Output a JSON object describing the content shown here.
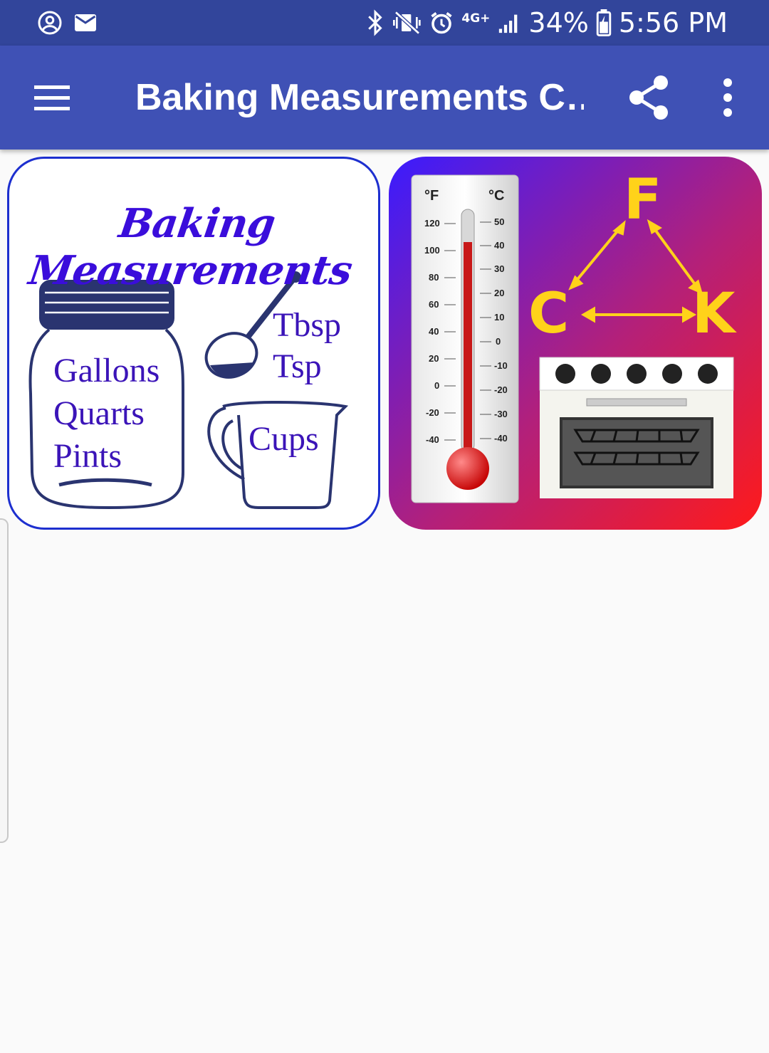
{
  "status_bar": {
    "network": "4G+",
    "battery": "34%",
    "time": "5:56 PM",
    "icons": [
      "account-circle-icon",
      "email-icon",
      "bluetooth-icon",
      "vibrate-icon",
      "alarm-icon",
      "signal-icon",
      "battery-charging-icon"
    ]
  },
  "app_bar": {
    "title": "Baking Measurements C…",
    "icons": [
      "menu-icon",
      "share-icon",
      "more-vert-icon"
    ]
  },
  "cards": {
    "measurements": {
      "title": "Baking Measurements",
      "jar_units": [
        "Gallons",
        "Quarts",
        "Pints"
      ],
      "spoon_units": [
        "Tbsp",
        "Tsp"
      ],
      "cup_unit": "Cups"
    },
    "temperature": {
      "units": {
        "f": "°F",
        "c": "°C"
      },
      "f_scale": [
        "120",
        "100",
        "80",
        "60",
        "40",
        "20",
        "0",
        "-20",
        "-40"
      ],
      "c_scale": [
        "50",
        "40",
        "30",
        "20",
        "10",
        "0",
        "-10",
        "-20",
        "-30",
        "-40"
      ],
      "letters": {
        "f": "F",
        "c": "C",
        "k": "K"
      }
    }
  },
  "colors": {
    "status_bar": "#32459b",
    "app_bar": "#3f51b5",
    "measure_text": "#3b14b8",
    "temp_gradient_start": "#3a1cff",
    "temp_gradient_end": "#ff1a1a",
    "letters": "#ffd21a"
  }
}
